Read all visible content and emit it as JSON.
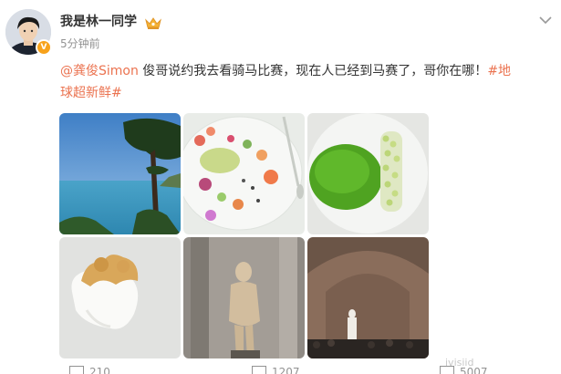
{
  "post": {
    "username": "我是林一同学",
    "timestamp": "5分钟前",
    "text": {
      "mention": "@龚俊Simon",
      "body": " 俊哥说约我去看骑马比赛，现在人已经到马赛了，哥你在哪！",
      "hashtag_line1": "#地",
      "hashtag_line2": "球超新鲜#"
    },
    "badge": "V",
    "icons": {
      "verified": "verified-badge-icon",
      "crown": "vip-crown-icon",
      "more": "chevron-down-icon"
    },
    "images": [
      {
        "name": "coastal-sea-view-photo"
      },
      {
        "name": "fine-dining-plate-photo"
      },
      {
        "name": "green-sauce-dish-photo"
      },
      {
        "name": "cream-dessert-photo"
      },
      {
        "name": "ancient-statue-photo"
      },
      {
        "name": "museum-hall-statue-photo"
      }
    ]
  },
  "footer": {
    "repost_count": "210",
    "comment_count": "1207",
    "like_count": "5007",
    "watermark": "ivisiid"
  },
  "colors": {
    "link": "#eb7350",
    "text": "#333333",
    "meta": "#939393",
    "badge": "#f7a21b"
  }
}
